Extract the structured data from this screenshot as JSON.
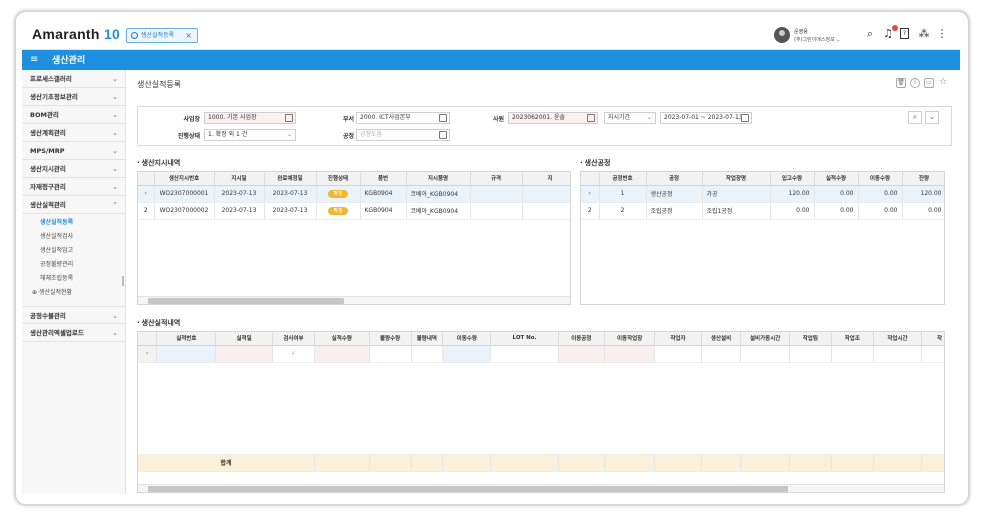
{
  "app": {
    "brand": "Amaranth",
    "version": "10",
    "open_tab": "생산실적등록"
  },
  "user": {
    "name": "운영용",
    "org": "(주)그린이에스정보"
  },
  "header_icons": [
    "search-icon",
    "bell-icon",
    "document-icon",
    "org-chart-icon",
    "more-vert-icon"
  ],
  "module_title": "생산관리",
  "sidebar": {
    "items": [
      {
        "label": "프로세스갤러리"
      },
      {
        "label": "생산기초정보관리"
      },
      {
        "label": "BOM관리"
      },
      {
        "label": "생산계획관리"
      },
      {
        "label": "MPS/MRP"
      },
      {
        "label": "생산지시관리"
      },
      {
        "label": "자재청구관리"
      },
      {
        "label": "생산실적관리"
      }
    ],
    "subitems": [
      {
        "label": "생산실적등록",
        "active": true
      },
      {
        "label": "생산실적검사"
      },
      {
        "label": "생산실적입고"
      },
      {
        "label": "공정불량관리"
      },
      {
        "label": "해체조립등록"
      },
      {
        "label": "생산실적현황"
      }
    ],
    "items_after": [
      {
        "label": "공정수불관리"
      },
      {
        "label": "생산관리엑셀업로드"
      }
    ]
  },
  "page": {
    "title": "생산실적등록"
  },
  "filter": {
    "biz_label": "사업장",
    "biz_value": "1000. 기본 사업장",
    "dept_label": "부서",
    "dept_value": "2000. ICT사업본부",
    "emp_label": "사원",
    "emp_value": "2023062001. 윤솔",
    "period_type": "지시기간",
    "period_value": "2023-07-01 ~ 2023-07-13",
    "status_label": "진행상태",
    "status_value": "1. 확정 외 1 건",
    "process_label": "공정",
    "process_placeholder": "공정도움"
  },
  "orders": {
    "title": "생산지시내역",
    "columns": [
      "생산지시번호",
      "지시일",
      "완료예정일",
      "진행상태",
      "품번",
      "지시품명",
      "규격",
      "지"
    ],
    "rows": [
      {
        "no": "WO2307000001",
        "date": "2023-07-13",
        "due": "2023-07-13",
        "status": "확정",
        "item": "KGB0904",
        "name": "코베아_KGB0904",
        "spec": ""
      },
      {
        "no": "WO2307000002",
        "date": "2023-07-13",
        "due": "2023-07-13",
        "status": "확정",
        "item": "KGB0904",
        "name": "코베아_KGB0904",
        "spec": ""
      }
    ]
  },
  "process": {
    "title": "생산공정",
    "columns": [
      "공정번호",
      "공정",
      "작업장명",
      "입고수량",
      "실적수량",
      "이동수량",
      "잔량"
    ],
    "rows": [
      {
        "seq": "1",
        "proc": "생산공정",
        "wc": "가공",
        "in": "120.00",
        "perf": "0.00",
        "move": "0.00",
        "rest": "120.00"
      },
      {
        "seq": "2",
        "proc": "조립공정",
        "wc": "조립1공정",
        "in": "0.00",
        "perf": "0.00",
        "move": "0.00",
        "rest": "0.00"
      }
    ]
  },
  "results": {
    "title": "생산실적내역",
    "columns": [
      "실적번호",
      "실적일",
      "검사여부",
      "실적수량",
      "불량수량",
      "불량내역",
      "이동수량",
      "LOT No.",
      "이동공정",
      "이동작업장",
      "작업자",
      "생산설비",
      "설비가동시간",
      "작업팀",
      "작업조",
      "작업시간",
      "작"
    ],
    "total_label": "합계"
  }
}
